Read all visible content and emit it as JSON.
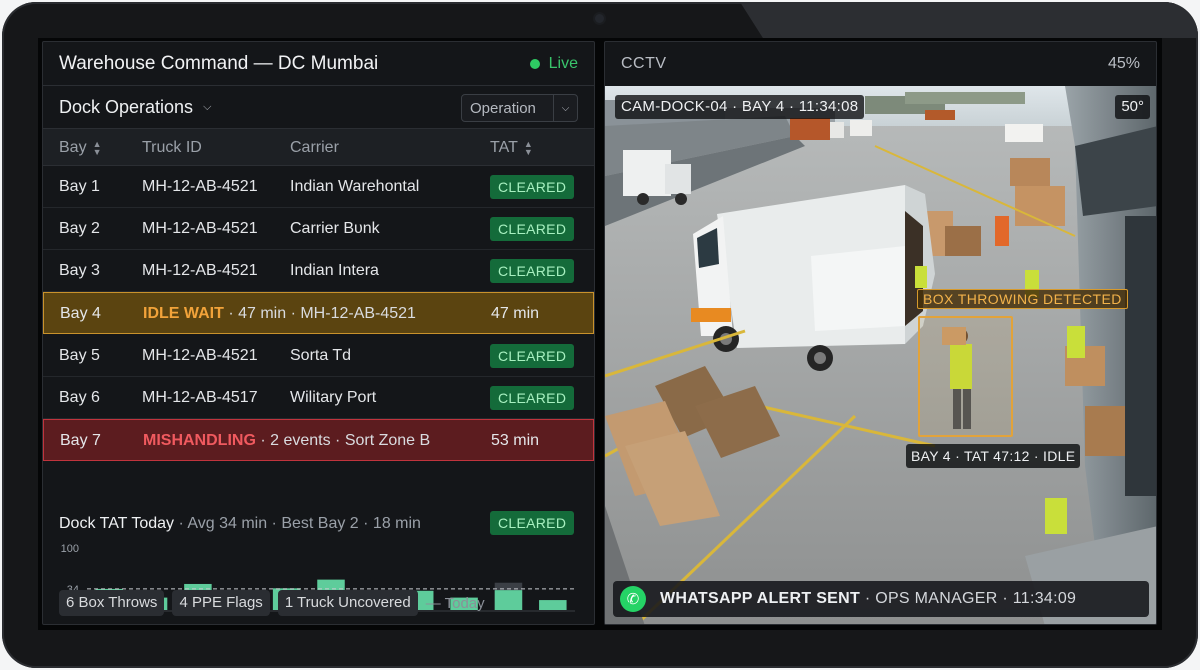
{
  "header": {
    "title": "Warehouse Command — DC Mumbai",
    "live_label": "Live",
    "live_color": "#2ecc63"
  },
  "subheader": {
    "title": "Dock Operations",
    "filter_value": "Operation"
  },
  "table": {
    "columns": [
      "Bay",
      "Truck ID",
      "Carrier",
      "TAT"
    ],
    "rows": [
      {
        "bay": "Bay 1",
        "truck": "MH-12-AB-4521",
        "carrier": "Indian Warehontal",
        "status": "CLEARED"
      },
      {
        "bay": "Bay 2",
        "truck": "MH-12-AB-4521",
        "carrier": "Carrier Bᴜnk",
        "status": "CLEARED"
      },
      {
        "bay": "Bay 3",
        "truck": "MH-12-AB-4521",
        "carrier": "Indian Intera",
        "status": "CLEARED"
      },
      {
        "bay": "Bay 4",
        "alert": "IDLE WAIT",
        "detail": " · 47 min · MH-12-AB-4521",
        "tat": "47 min"
      },
      {
        "bay": "Bay 5",
        "truck": "MH-12-AB-4521",
        "carrier": "Sorta Td",
        "status": "CLEARED"
      },
      {
        "bay": "Bay 6",
        "truck": "MH-12-AB-4517",
        "carrier": "Wilitary Port",
        "status": "CLEARED"
      },
      {
        "bay": "Bay 7",
        "alert": "MISHANDLING",
        "detail": " · 2 events · Sort Zone B",
        "tat": "53 min"
      }
    ]
  },
  "tat": {
    "title": "Dock TAT Today",
    "meta": " · Avg 34 min · Best Bay 2 · 18 min",
    "badge": "CLEARED"
  },
  "chart_data": {
    "type": "bar",
    "categories": [
      "",
      "",
      "",
      "",
      "",
      "",
      "",
      "",
      "",
      "",
      "",
      ""
    ],
    "values": [
      34,
      20,
      42,
      24,
      35,
      49,
      25,
      31,
      20,
      32,
      16
    ],
    "ylim": [
      0,
      100
    ],
    "yticks": [
      "100",
      "34",
      "0"
    ],
    "reference_line": 34,
    "bar_color": "#5ecc9b",
    "highlight_index": 9
  },
  "chips": [
    "6 Box Throws",
    "4 PPE Flags",
    "1 Truck Uncovered"
  ],
  "chips_suffix": "— Today",
  "cctv": {
    "title": "CCTV",
    "zoom": "45%",
    "camera_label": "CAM-DOCK-04 · BAY 4 · 11:34:08",
    "temperature": "50°",
    "detection_label": "BOX THROWING DETECTED",
    "bay_label": "BAY 4 · TAT 47:12 · IDLE",
    "alert_strong": "WHATSAPP ALERT SENT",
    "alert_meta": " · OPS MANAGER · 11:34:09"
  }
}
